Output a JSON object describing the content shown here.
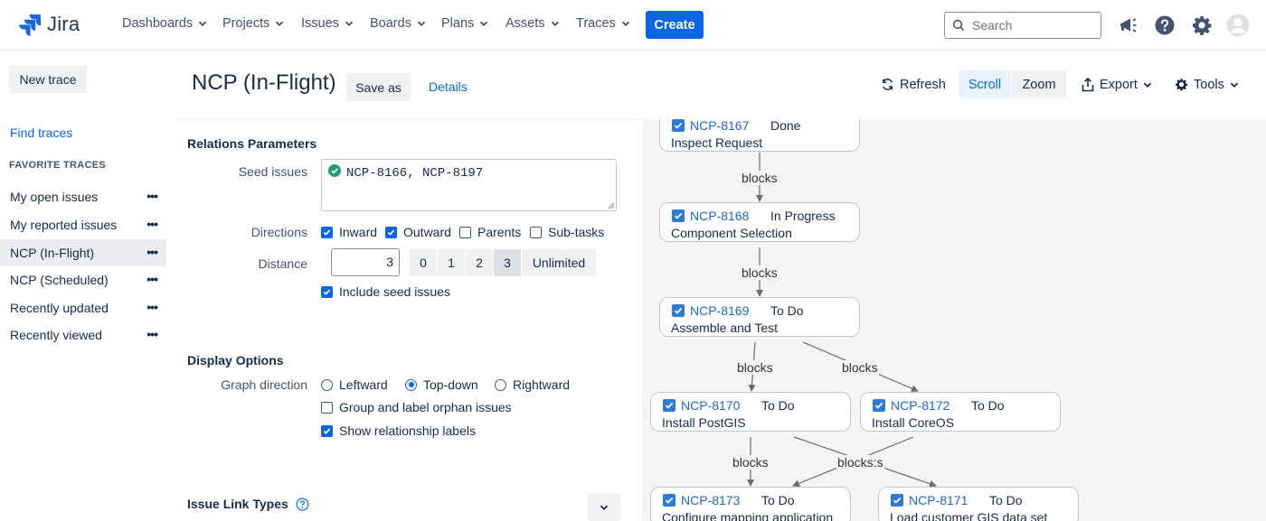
{
  "app": {
    "name": "Jira",
    "brand_color": "#0c66e4"
  },
  "topnav": {
    "items": [
      "Dashboards",
      "Projects",
      "Issues",
      "Boards",
      "Plans",
      "Assets",
      "Traces"
    ],
    "create_label": "Create",
    "search_placeholder": "Search",
    "icons": [
      "megaphone-icon",
      "help-icon",
      "settings-gear-icon",
      "avatar"
    ]
  },
  "sidebar": {
    "new_trace": "New trace",
    "find_traces": "Find traces",
    "favorites_heading": "FAVORITE TRACES",
    "items": [
      {
        "label": "My open issues",
        "active": false
      },
      {
        "label": "My reported issues",
        "active": false
      },
      {
        "label": "NCP (In-Flight)",
        "active": true
      },
      {
        "label": "NCP (Scheduled)",
        "active": false
      },
      {
        "label": "Recently updated",
        "active": false
      },
      {
        "label": "Recently viewed",
        "active": false
      }
    ]
  },
  "header": {
    "title": "NCP (In-Flight)",
    "save_as": "Save as",
    "details": "Details",
    "refresh": "Refresh",
    "scroll": "Scroll",
    "zoom": "Zoom",
    "export": "Export",
    "tools": "Tools"
  },
  "relations": {
    "section_title": "Relations Parameters",
    "seed_label": "Seed issues",
    "seed_value": "NCP-8166, NCP-8197",
    "directions_label": "Directions",
    "directions": [
      {
        "label": "Inward",
        "checked": true
      },
      {
        "label": "Outward",
        "checked": true
      },
      {
        "label": "Parents",
        "checked": false
      },
      {
        "label": "Sub-tasks",
        "checked": false
      }
    ],
    "distance_label": "Distance",
    "distance_value": "3",
    "distance_options": [
      "0",
      "1",
      "2",
      "3",
      "Unlimited"
    ],
    "distance_selected": "3",
    "include_seed_label": "Include seed issues",
    "include_seed_checked": true
  },
  "display": {
    "section_title": "Display Options",
    "graph_direction_label": "Graph direction",
    "graph_directions": [
      {
        "label": "Leftward",
        "selected": false
      },
      {
        "label": "Top-down",
        "selected": true
      },
      {
        "label": "Rightward",
        "selected": false
      }
    ],
    "group_orphans_label": "Group and label orphan issues",
    "group_orphans_checked": false,
    "show_labels_label": "Show relationship labels",
    "show_labels_checked": true
  },
  "link_types": {
    "section_title": "Issue Link Types"
  },
  "graph": {
    "nodes": [
      {
        "key": "NCP-8167",
        "status": "Done",
        "summary": "Inspect Request"
      },
      {
        "key": "NCP-8168",
        "status": "In Progress",
        "summary": "Component Selection"
      },
      {
        "key": "NCP-8169",
        "status": "To Do",
        "summary": "Assemble and Test"
      },
      {
        "key": "NCP-8170",
        "status": "To Do",
        "summary": "Install PostGIS"
      },
      {
        "key": "NCP-8172",
        "status": "To Do",
        "summary": "Install CoreOS"
      },
      {
        "key": "NCP-8173",
        "status": "To Do",
        "summary": "Configure mapping application"
      },
      {
        "key": "NCP-8171",
        "status": "To Do",
        "summary": "Load customer GIS data set"
      }
    ],
    "edge_label": "blocks",
    "edge_label_merged": "blocks:s"
  }
}
